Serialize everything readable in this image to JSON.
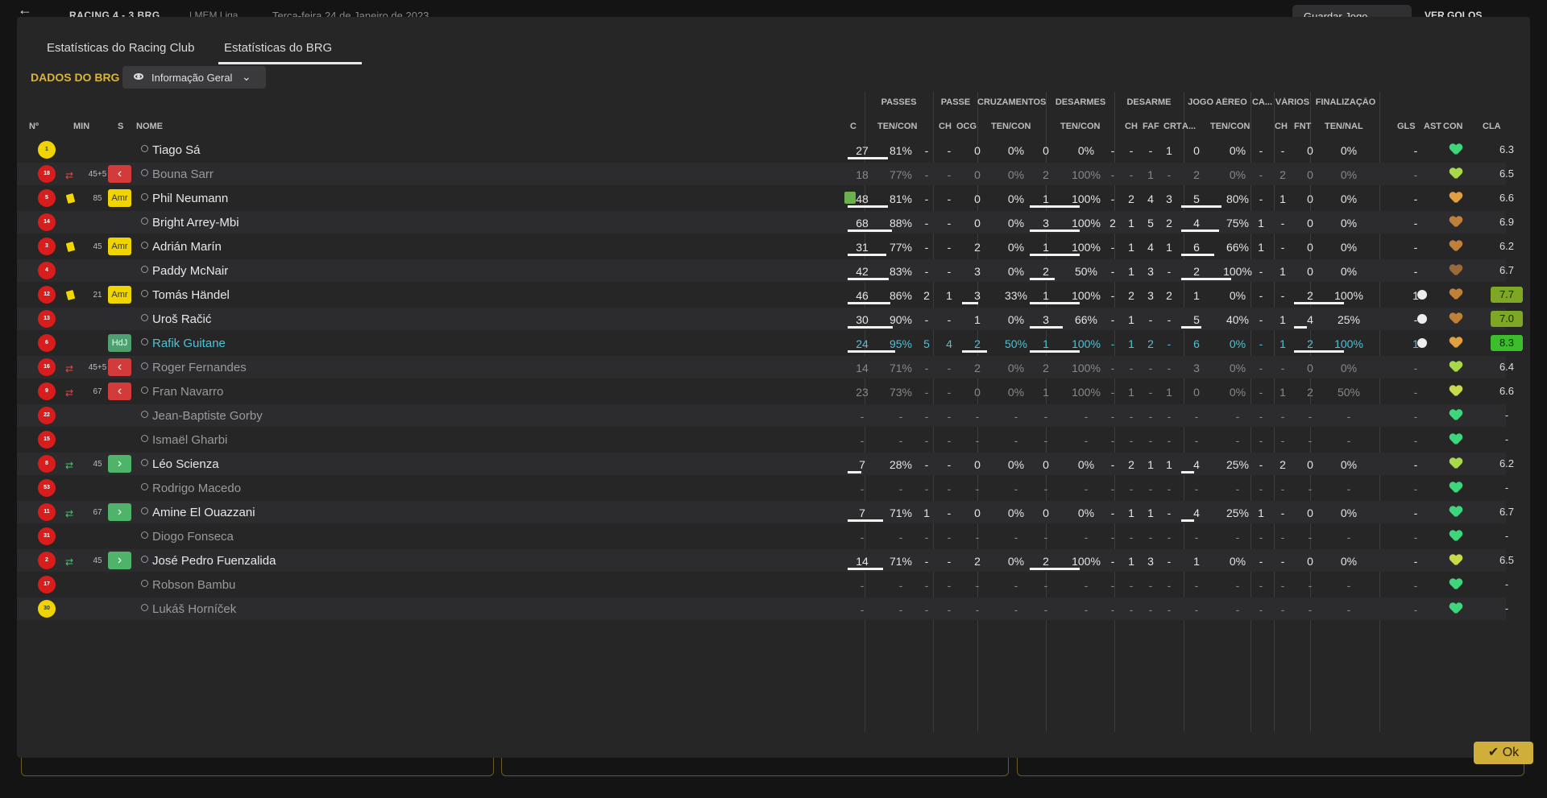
{
  "topbar": {
    "score": "RACING 4 - 3 BRG",
    "league": "| MEM Liga",
    "date": "Terça-feira 24 de Janeiro de 2023",
    "save": "Guardar Jogo",
    "goals": "VER GOLOS"
  },
  "tabs": [
    "Estatísticas do Racing Club",
    "Estatísticas do BRG"
  ],
  "section_label": "DADOS DO BRG",
  "view_button": "Informação Geral",
  "group_headers": [
    "PASSES",
    "PASSE",
    "CRUZAMENTOS",
    "DESARMES",
    "DESARME",
    "JOGO AÉREO",
    "CA...",
    "VÁRIOS",
    "FINALIZAÇÃO"
  ],
  "column_headers": [
    "Nº",
    "MIN",
    "S",
    "NOME",
    "C",
    "TEN/CON",
    "CH",
    "OCG",
    "TEN/CON",
    "TEN/CON",
    "CH",
    "FAF",
    "CRT",
    "A...",
    "TEN/CON",
    "CH",
    "FNT",
    "TEN/NAL",
    "GLS",
    "AST",
    "CON",
    "CLA"
  ],
  "ok_label": "Ok",
  "players": [
    {
      "no": "1",
      "gk": true,
      "min": "",
      "card": "",
      "swap": "",
      "badge": "",
      "name": "Tiago Sá",
      "style": "",
      "c": "",
      "pt": "27",
      "pp": "81%",
      "pch": "-",
      "ocg": "-",
      "cr": "0",
      "crp": "0%",
      "ds": "0",
      "dsp": "0%",
      "dch": "-",
      "faf": "-",
      "crt": "-",
      "a": "1",
      "ja": "0",
      "jap": "0%",
      "ca": "-",
      "fnt": "-",
      "fin": "0",
      "finp": "0%",
      "gls": "",
      "ast": "-",
      "con": "#3ed67a",
      "cla": "6.3",
      "ratingClass": ""
    },
    {
      "no": "18",
      "gk": false,
      "min": "45+5",
      "card": "",
      "swap": "out",
      "badge": "out",
      "name": "Bouna Sarr",
      "style": "sub",
      "c": "",
      "pt": "18",
      "pp": "77%",
      "pch": "-",
      "ocg": "-",
      "cr": "0",
      "crp": "0%",
      "ds": "2",
      "dsp": "100%",
      "dch": "-",
      "faf": "-",
      "crt": "1",
      "a": "-",
      "ja": "2",
      "jap": "0%",
      "ca": "-",
      "fnt": "2",
      "fin": "0",
      "finp": "0%",
      "gls": "",
      "ast": "-",
      "con": "#a7d94a",
      "cla": "6.5",
      "ratingClass": ""
    },
    {
      "no": "5",
      "gk": false,
      "min": "85",
      "card": "y",
      "swap": "",
      "badge": "amr",
      "name": "Phil Neumann",
      "style": "",
      "c": "bin",
      "pt": "48",
      "pp": "81%",
      "pch": "-",
      "ocg": "-",
      "cr": "0",
      "crp": "0%",
      "ds": "1",
      "dsp": "100%",
      "dch": "-",
      "faf": "2",
      "crt": "4",
      "a": "3",
      "ja": "5",
      "jap": "80%",
      "ca": "-",
      "fnt": "1",
      "fin": "0",
      "finp": "0%",
      "gls": "",
      "ast": "-",
      "con": "#e0a040",
      "cla": "6.6",
      "ratingClass": ""
    },
    {
      "no": "14",
      "gk": false,
      "min": "",
      "card": "",
      "swap": "",
      "badge": "",
      "name": "Bright Arrey-Mbi",
      "style": "",
      "c": "",
      "pt": "68",
      "pp": "88%",
      "pch": "-",
      "ocg": "-",
      "cr": "0",
      "crp": "0%",
      "ds": "3",
      "dsp": "100%",
      "dch": "2",
      "faf": "1",
      "crt": "5",
      "a": "2",
      "ja": "4",
      "jap": "75%",
      "ca": "1",
      "fnt": "-",
      "fin": "0",
      "finp": "0%",
      "gls": "",
      "ast": "-",
      "con": "#c0803a",
      "cla": "6.9",
      "ratingClass": ""
    },
    {
      "no": "3",
      "gk": false,
      "min": "45",
      "card": "y",
      "swap": "",
      "badge": "amr",
      "name": "Adrián Marín",
      "style": "",
      "c": "",
      "pt": "31",
      "pp": "77%",
      "pch": "-",
      "ocg": "-",
      "cr": "2",
      "crp": "0%",
      "ds": "1",
      "dsp": "100%",
      "dch": "-",
      "faf": "1",
      "crt": "4",
      "a": "1",
      "ja": "6",
      "jap": "66%",
      "ca": "1",
      "fnt": "-",
      "fin": "0",
      "finp": "0%",
      "gls": "",
      "ast": "-",
      "con": "#c0803a",
      "cla": "6.2",
      "ratingClass": ""
    },
    {
      "no": "4",
      "gk": false,
      "min": "",
      "card": "",
      "swap": "",
      "badge": "",
      "name": "Paddy McNair",
      "style": "",
      "c": "",
      "pt": "42",
      "pp": "83%",
      "pch": "-",
      "ocg": "-",
      "cr": "3",
      "crp": "0%",
      "ds": "2",
      "dsp": "50%",
      "dch": "-",
      "faf": "1",
      "crt": "3",
      "a": "-",
      "ja": "2",
      "jap": "100%",
      "ca": "-",
      "fnt": "1",
      "fin": "0",
      "finp": "0%",
      "gls": "",
      "ast": "-",
      "con": "#9a6a3a",
      "cla": "6.7",
      "ratingClass": ""
    },
    {
      "no": "12",
      "gk": false,
      "min": "21",
      "card": "y",
      "swap": "",
      "badge": "amr",
      "name": "Tomás Händel",
      "style": "",
      "c": "",
      "pt": "46",
      "pp": "86%",
      "pch": "2",
      "ocg": "1",
      "cr": "3",
      "crp": "33%",
      "ds": "1",
      "dsp": "100%",
      "dch": "-",
      "faf": "2",
      "crt": "3",
      "a": "2",
      "ja": "1",
      "jap": "0%",
      "ca": "-",
      "fnt": "-",
      "fin": "2",
      "finp": "100%",
      "gls": "ball",
      "ast": "1",
      "con": "#c0803a",
      "cla": "7.7",
      "ratingClass": "mid"
    },
    {
      "no": "13",
      "gk": false,
      "min": "",
      "card": "",
      "swap": "",
      "badge": "",
      "name": "Uroš Račić",
      "style": "",
      "c": "",
      "pt": "30",
      "pp": "90%",
      "pch": "-",
      "ocg": "-",
      "cr": "1",
      "crp": "0%",
      "ds": "3",
      "dsp": "66%",
      "dch": "-",
      "faf": "1",
      "crt": "-",
      "a": "-",
      "ja": "5",
      "jap": "40%",
      "ca": "-",
      "fnt": "1",
      "fin": "4",
      "finp": "25%",
      "gls": "ball",
      "ast": "-",
      "con": "#c0803a",
      "cla": "7.0",
      "ratingClass": "mid"
    },
    {
      "no": "6",
      "gk": false,
      "min": "",
      "card": "",
      "swap": "",
      "badge": "hdj",
      "name": "Rafik Guitane",
      "style": "sel",
      "c": "",
      "pt": "24",
      "pp": "95%",
      "pch": "5",
      "ocg": "4",
      "cr": "2",
      "crp": "50%",
      "ds": "1",
      "dsp": "100%",
      "dch": "-",
      "faf": "1",
      "crt": "2",
      "a": "-",
      "ja": "6",
      "jap": "0%",
      "ca": "-",
      "fnt": "1",
      "fin": "2",
      "finp": "100%",
      "gls": "ball",
      "ast": "1",
      "con": "#e0a040",
      "cla": "8.3",
      "ratingClass": "hi"
    },
    {
      "no": "16",
      "gk": false,
      "min": "45+5",
      "card": "",
      "swap": "out",
      "badge": "out",
      "name": "Roger Fernandes",
      "style": "sub",
      "c": "",
      "pt": "14",
      "pp": "71%",
      "pch": "-",
      "ocg": "-",
      "cr": "2",
      "crp": "0%",
      "ds": "2",
      "dsp": "100%",
      "dch": "-",
      "faf": "-",
      "crt": "-",
      "a": "-",
      "ja": "3",
      "jap": "0%",
      "ca": "-",
      "fnt": "-",
      "fin": "0",
      "finp": "0%",
      "gls": "",
      "ast": "-",
      "con": "#a7d94a",
      "cla": "6.4",
      "ratingClass": ""
    },
    {
      "no": "9",
      "gk": false,
      "min": "67",
      "card": "",
      "swap": "out",
      "badge": "out",
      "name": "Fran Navarro",
      "style": "sub",
      "c": "",
      "pt": "23",
      "pp": "73%",
      "pch": "-",
      "ocg": "-",
      "cr": "0",
      "crp": "0%",
      "ds": "1",
      "dsp": "100%",
      "dch": "-",
      "faf": "1",
      "crt": "-",
      "a": "1",
      "ja": "0",
      "jap": "0%",
      "ca": "-",
      "fnt": "1",
      "fin": "2",
      "finp": "50%",
      "gls": "",
      "ast": "-",
      "con": "#c8d94a",
      "cla": "6.6",
      "ratingClass": ""
    },
    {
      "no": "22",
      "gk": false,
      "min": "",
      "card": "",
      "swap": "",
      "badge": "",
      "name": "Jean-Baptiste Gorby",
      "style": "sub",
      "c": "",
      "pt": "-",
      "pp": "-",
      "pch": "-",
      "ocg": "-",
      "cr": "-",
      "crp": "-",
      "ds": "-",
      "dsp": "-",
      "dch": "-",
      "faf": "-",
      "crt": "-",
      "a": "-",
      "ja": "-",
      "jap": "-",
      "ca": "-",
      "fnt": "-",
      "fin": "-",
      "finp": "-",
      "gls": "",
      "ast": "-",
      "con": "#3ed67a",
      "cla": "-",
      "ratingClass": ""
    },
    {
      "no": "15",
      "gk": false,
      "min": "",
      "card": "",
      "swap": "",
      "badge": "",
      "name": "Ismaël Gharbi",
      "style": "sub",
      "c": "",
      "pt": "-",
      "pp": "-",
      "pch": "-",
      "ocg": "-",
      "cr": "-",
      "crp": "-",
      "ds": "-",
      "dsp": "-",
      "dch": "-",
      "faf": "-",
      "crt": "-",
      "a": "-",
      "ja": "-",
      "jap": "-",
      "ca": "-",
      "fnt": "-",
      "fin": "-",
      "finp": "-",
      "gls": "",
      "ast": "-",
      "con": "#3ed67a",
      "cla": "-",
      "ratingClass": ""
    },
    {
      "no": "8",
      "gk": false,
      "min": "45",
      "card": "",
      "swap": "in",
      "badge": "in",
      "name": "Léo Scienza",
      "style": "",
      "c": "",
      "pt": "7",
      "pp": "28%",
      "pch": "-",
      "ocg": "-",
      "cr": "0",
      "crp": "0%",
      "ds": "0",
      "dsp": "0%",
      "dch": "-",
      "faf": "2",
      "crt": "1",
      "a": "1",
      "ja": "4",
      "jap": "25%",
      "ca": "-",
      "fnt": "2",
      "fin": "0",
      "finp": "0%",
      "gls": "",
      "ast": "-",
      "con": "#a7d94a",
      "cla": "6.2",
      "ratingClass": ""
    },
    {
      "no": "53",
      "gk": false,
      "min": "",
      "card": "",
      "swap": "",
      "badge": "",
      "name": "Rodrigo Macedo",
      "style": "sub",
      "c": "",
      "pt": "-",
      "pp": "-",
      "pch": "-",
      "ocg": "-",
      "cr": "-",
      "crp": "-",
      "ds": "-",
      "dsp": "-",
      "dch": "-",
      "faf": "-",
      "crt": "-",
      "a": "-",
      "ja": "-",
      "jap": "-",
      "ca": "-",
      "fnt": "-",
      "fin": "-",
      "finp": "-",
      "gls": "",
      "ast": "-",
      "con": "#3ed67a",
      "cla": "-",
      "ratingClass": ""
    },
    {
      "no": "11",
      "gk": false,
      "min": "67",
      "card": "",
      "swap": "in",
      "badge": "in",
      "name": "Amine El Ouazzani",
      "style": "",
      "c": "",
      "pt": "7",
      "pp": "71%",
      "pch": "1",
      "ocg": "-",
      "cr": "0",
      "crp": "0%",
      "ds": "0",
      "dsp": "0%",
      "dch": "-",
      "faf": "1",
      "crt": "1",
      "a": "-",
      "ja": "4",
      "jap": "25%",
      "ca": "1",
      "fnt": "-",
      "fin": "0",
      "finp": "0%",
      "gls": "",
      "ast": "-",
      "con": "#3ed67a",
      "cla": "6.7",
      "ratingClass": ""
    },
    {
      "no": "31",
      "gk": false,
      "min": "",
      "card": "",
      "swap": "",
      "badge": "",
      "name": "Diogo Fonseca",
      "style": "sub",
      "c": "",
      "pt": "-",
      "pp": "-",
      "pch": "-",
      "ocg": "-",
      "cr": "-",
      "crp": "-",
      "ds": "-",
      "dsp": "-",
      "dch": "-",
      "faf": "-",
      "crt": "-",
      "a": "-",
      "ja": "-",
      "jap": "-",
      "ca": "-",
      "fnt": "-",
      "fin": "-",
      "finp": "-",
      "gls": "",
      "ast": "-",
      "con": "#3ed67a",
      "cla": "-",
      "ratingClass": ""
    },
    {
      "no": "2",
      "gk": false,
      "min": "45",
      "card": "",
      "swap": "in",
      "badge": "in",
      "name": "José Pedro Fuenzalida",
      "style": "",
      "c": "",
      "pt": "14",
      "pp": "71%",
      "pch": "-",
      "ocg": "-",
      "cr": "2",
      "crp": "0%",
      "ds": "2",
      "dsp": "100%",
      "dch": "-",
      "faf": "1",
      "crt": "3",
      "a": "-",
      "ja": "1",
      "jap": "0%",
      "ca": "-",
      "fnt": "-",
      "fin": "0",
      "finp": "0%",
      "gls": "",
      "ast": "-",
      "con": "#c8d94a",
      "cla": "6.5",
      "ratingClass": ""
    },
    {
      "no": "17",
      "gk": false,
      "min": "",
      "card": "",
      "swap": "",
      "badge": "",
      "name": "Robson Bambu",
      "style": "sub",
      "c": "",
      "pt": "-",
      "pp": "-",
      "pch": "-",
      "ocg": "-",
      "cr": "-",
      "crp": "-",
      "ds": "-",
      "dsp": "-",
      "dch": "-",
      "faf": "-",
      "crt": "-",
      "a": "-",
      "ja": "-",
      "jap": "-",
      "ca": "-",
      "fnt": "-",
      "fin": "-",
      "finp": "-",
      "gls": "",
      "ast": "-",
      "con": "#3ed67a",
      "cla": "-",
      "ratingClass": ""
    },
    {
      "no": "30",
      "gk": true,
      "min": "",
      "card": "",
      "swap": "",
      "badge": "",
      "name": "Lukáš Horníček",
      "style": "sub",
      "c": "",
      "pt": "-",
      "pp": "-",
      "pch": "-",
      "ocg": "-",
      "cr": "-",
      "crp": "-",
      "ds": "-",
      "dsp": "-",
      "dch": "-",
      "faf": "-",
      "crt": "-",
      "a": "-",
      "ja": "-",
      "jap": "-",
      "ca": "-",
      "fnt": "-",
      "fin": "-",
      "finp": "-",
      "gls": "",
      "ast": "-",
      "con": "#3ed67a",
      "cla": "-",
      "ratingClass": ""
    }
  ]
}
